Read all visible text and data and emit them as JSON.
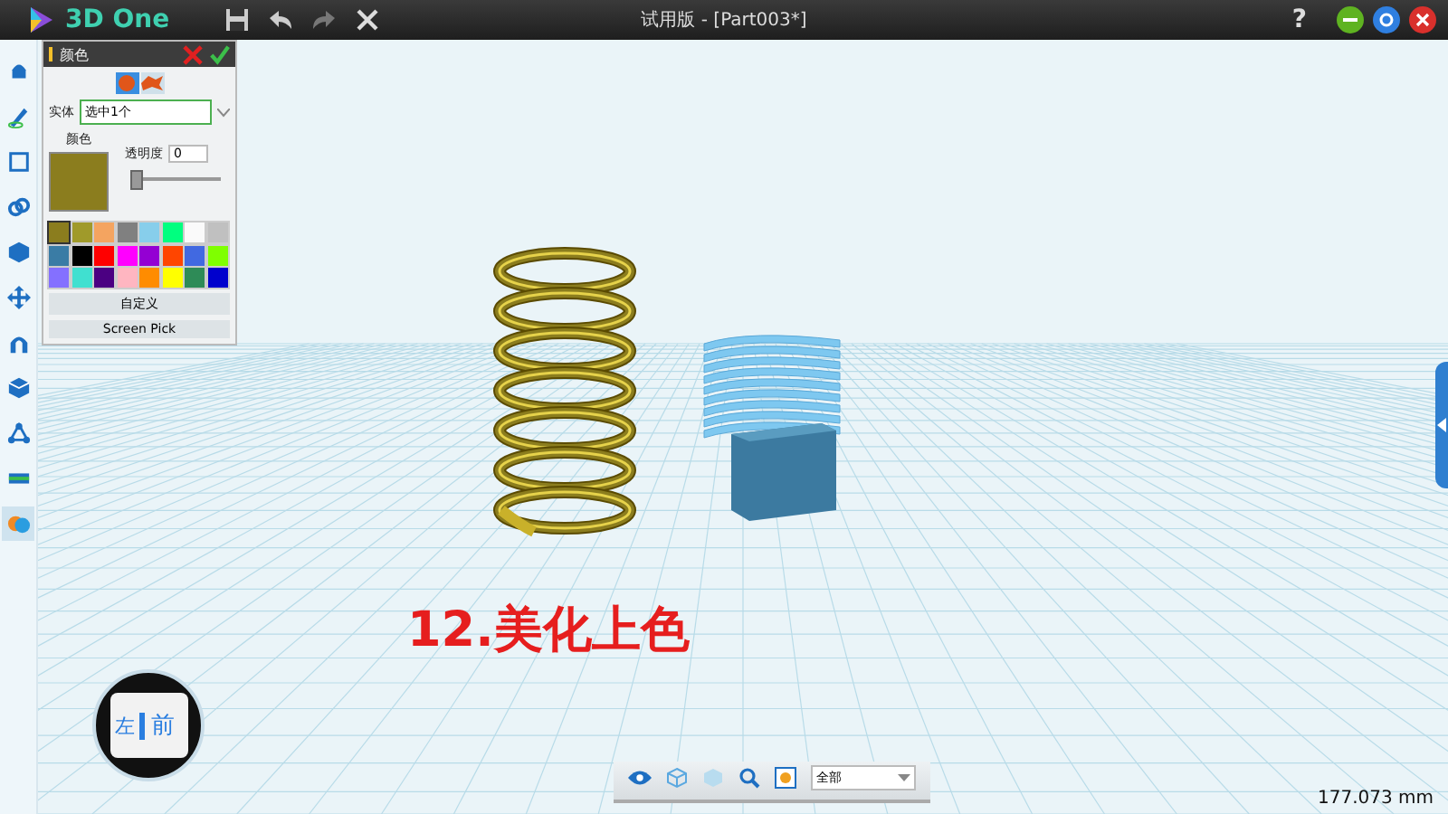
{
  "window": {
    "app_name": "3D One",
    "title": "试用版 - [Part003*]",
    "help": "?"
  },
  "left_toolbar": [
    {
      "selected": false
    },
    {
      "selected": false
    },
    {
      "selected": false
    },
    {
      "selected": false
    },
    {
      "selected": false
    },
    {
      "selected": false
    },
    {
      "selected": false
    },
    {
      "selected": false
    },
    {
      "selected": false
    },
    {
      "selected": false
    },
    {
      "selected": true
    }
  ],
  "color_panel": {
    "title": "颜色",
    "entity_label": "实体",
    "entity_value": "选中1个",
    "color_label": "颜色",
    "transparency_label": "透明度",
    "transparency_value": "0",
    "transparency": {
      "level": 0
    },
    "swatches": [
      {
        "color": "#8b7d1e",
        "selected": true
      },
      {
        "color": "#a09a2a",
        "selected": false
      },
      {
        "color": "#f4a460",
        "selected": false
      },
      {
        "color": "#808080",
        "selected": false
      },
      {
        "color": "#87ceeb",
        "selected": false
      },
      {
        "color": "#00ff7f",
        "selected": false
      },
      {
        "color": "#fafafa",
        "selected": false
      },
      {
        "color": "#c0c0c0",
        "selected": false
      },
      {
        "color": "#3a7ca5",
        "selected": false
      },
      {
        "color": "#000000",
        "selected": false
      },
      {
        "color": "#ff0000",
        "selected": false
      },
      {
        "color": "#ff00ff",
        "selected": false
      },
      {
        "color": "#9400d3",
        "selected": false
      },
      {
        "color": "#ff4500",
        "selected": false
      },
      {
        "color": "#4169e1",
        "selected": false
      },
      {
        "color": "#7fff00",
        "selected": false
      },
      {
        "color": "#8470ff",
        "selected": false
      },
      {
        "color": "#40e0d0",
        "selected": false
      },
      {
        "color": "#4b0082",
        "selected": false
      },
      {
        "color": "#ffb6c1",
        "selected": false
      },
      {
        "color": "#ff8c00",
        "selected": false
      },
      {
        "color": "#ffff00",
        "selected": false
      },
      {
        "color": "#2e8b57",
        "selected": false
      },
      {
        "color": "#0000cd",
        "selected": false
      }
    ],
    "buttons": [
      "自定义",
      "Screen Pick"
    ]
  },
  "caption": "12.美化上色",
  "view_cube": {
    "left": "左",
    "front": "前"
  },
  "bottom_toolbar": {
    "filter": "全部"
  },
  "status": {
    "measurement": "177.073 mm"
  }
}
